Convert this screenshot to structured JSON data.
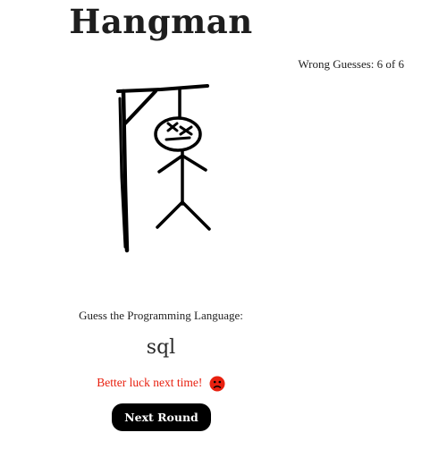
{
  "game": {
    "title": "Hangman",
    "wrong_guesses_label": "Wrong Guesses: 6 of 6",
    "wrong_guesses": 6,
    "max_guesses": 6,
    "prompt": "Guess the Programming Language:",
    "answer": "sql",
    "result_message": "Better luck next time!",
    "result_icon": "sad-face-icon",
    "next_round_label": "Next Round"
  },
  "colors": {
    "result_text": "#e8200f",
    "button_background": "#000000",
    "button_text": "#ffffff"
  }
}
